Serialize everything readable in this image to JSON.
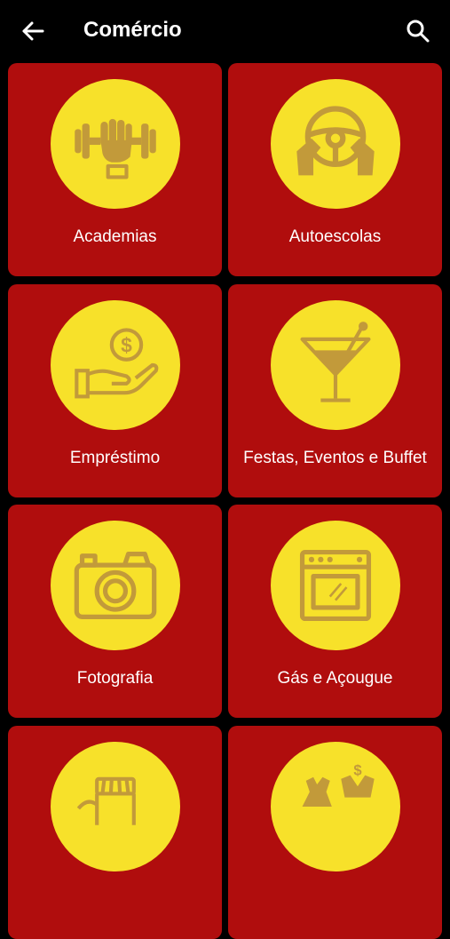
{
  "header": {
    "title": "Comércio",
    "back_icon": "arrow-left-icon",
    "search_icon": "search-icon"
  },
  "colors": {
    "background": "#000000",
    "card": "#b00d0d",
    "circle": "#f7e12a",
    "icon": "#c29a3a",
    "text": "#ffffff"
  },
  "categories": [
    {
      "label": "Academias",
      "icon": "dumbbell-fist-icon"
    },
    {
      "label": "Autoescolas",
      "icon": "steering-wheel-icon"
    },
    {
      "label": "Empréstimo",
      "icon": "money-hand-icon"
    },
    {
      "label": "Festas, Eventos e Buffet",
      "icon": "cocktail-glass-icon"
    },
    {
      "label": "Fotografia",
      "icon": "camera-icon"
    },
    {
      "label": "Gás e Açougue",
      "icon": "oven-icon"
    },
    {
      "label": "",
      "icon": "storefront-icon"
    },
    {
      "label": "",
      "icon": "clothing-icon"
    }
  ]
}
